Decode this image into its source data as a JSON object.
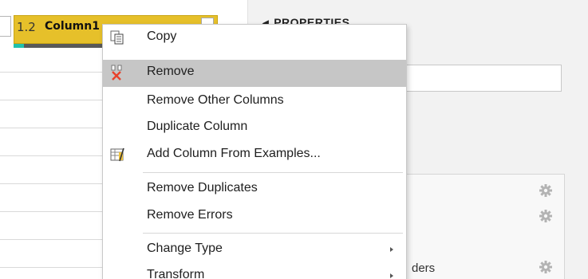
{
  "grid": {
    "column": {
      "type_label": "1.2",
      "name": "Column1"
    }
  },
  "properties": {
    "heading": "PROPERTIES",
    "applied_steps": [
      {
        "label": ""
      },
      {
        "label": ""
      },
      {
        "label": "ders"
      }
    ]
  },
  "context_menu": {
    "items": [
      {
        "label": "Copy",
        "icon": "copy-icon"
      },
      {
        "label": "Remove",
        "icon": "remove-column-icon",
        "highlighted": true
      },
      {
        "label": "Remove Other Columns"
      },
      {
        "label": "Duplicate Column"
      },
      {
        "label": "Add Column From Examples...",
        "icon": "add-column-from-examples-icon"
      },
      {
        "label": "Remove Duplicates"
      },
      {
        "label": "Remove Errors"
      },
      {
        "label": "Change Type",
        "submenu": true
      },
      {
        "label": "Transform",
        "submenu": true
      }
    ]
  },
  "colors": {
    "column_header": "#e6c02a",
    "quality_valid": "#21c1ad",
    "menu_highlight": "#c6c6c6",
    "remove_icon": "#e8412b"
  }
}
